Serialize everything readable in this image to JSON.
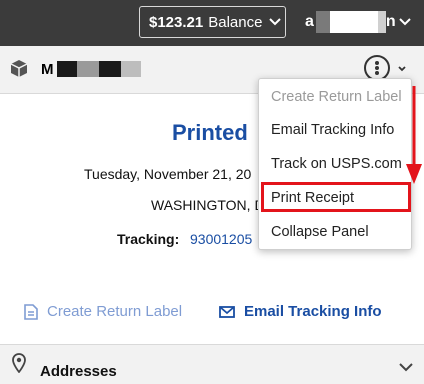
{
  "topbar": {
    "balance_amount": "$123.21",
    "balance_label": "Balance",
    "user_initial": "a",
    "user_trailing": "n"
  },
  "shipment": {
    "name_initial": "M"
  },
  "status": {
    "title": "Printed",
    "date": "Tuesday, November 21, 20",
    "city": "WASHINGTON, D",
    "tracking_label": "Tracking:",
    "tracking_number": "93001205"
  },
  "actions": {
    "create_return": "Create Return Label",
    "email_tracking": "Email Tracking Info"
  },
  "addresses": {
    "label": "Addresses"
  },
  "menu": {
    "items": [
      {
        "label": "Create Return Label",
        "disabled": true
      },
      {
        "label": "Email Tracking Info",
        "disabled": false
      },
      {
        "label": "Track on USPS.com",
        "disabled": false
      },
      {
        "label": "Print Receipt",
        "disabled": false,
        "highlighted": true
      },
      {
        "label": "Collapse Panel",
        "disabled": false
      }
    ]
  },
  "colors": {
    "topbar": "#3b3b3b",
    "link": "#1a4ea3",
    "link_disabled": "#7f9cd3",
    "highlight": "#e3141b"
  },
  "icons": [
    "chevron-down-icon",
    "box-icon",
    "kebab-menu-icon",
    "document-icon",
    "envelope-icon",
    "map-pin-icon"
  ]
}
